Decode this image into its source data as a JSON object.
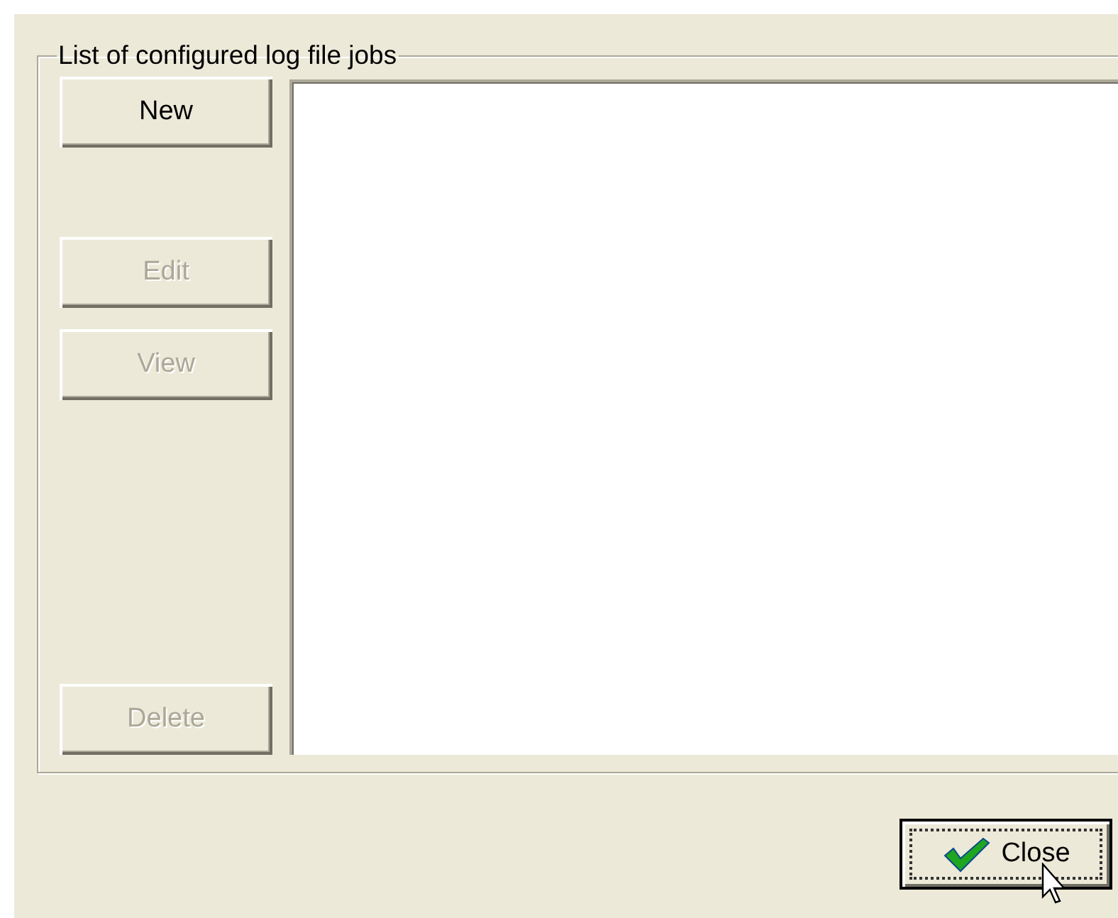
{
  "group": {
    "title": "List of configured log file jobs",
    "buttons": [
      {
        "label": "New",
        "disabled": false
      },
      {
        "label": "Edit",
        "disabled": true
      },
      {
        "label": "View",
        "disabled": true
      },
      {
        "label": "Delete",
        "disabled": true
      }
    ]
  },
  "close_button": {
    "label": "Close",
    "focused": true
  }
}
